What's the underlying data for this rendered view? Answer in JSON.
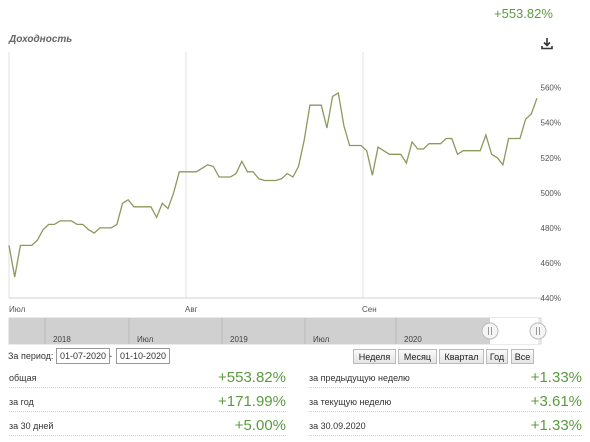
{
  "header": {
    "total_return": "+553.82%",
    "title": "Доходность",
    "download_icon": "download-icon"
  },
  "chart_data": {
    "type": "line",
    "title": "Доходность",
    "xlabel": "",
    "ylabel": "",
    "x_ticks": [
      "Июл",
      "Авг",
      "Сен"
    ],
    "y_ticks": [
      "440%",
      "460%",
      "480%",
      "500%",
      "520%",
      "540%",
      "560%"
    ],
    "ylim": [
      440,
      570
    ],
    "series_color": "#8a9a5b",
    "grid": "vertical lines at month starts",
    "series": [
      {
        "values": [
          470,
          452,
          470,
          470,
          470,
          473,
          479,
          482,
          482,
          484,
          484,
          484,
          482,
          482,
          479,
          477,
          480,
          480,
          480,
          482,
          494,
          496,
          492,
          492,
          492,
          492,
          486,
          494,
          491,
          500,
          512,
          512,
          512,
          512,
          514,
          516,
          515,
          509,
          509,
          509,
          511,
          518,
          512,
          512,
          508,
          507,
          507,
          507,
          508,
          511,
          509,
          515,
          530,
          550,
          550,
          550,
          537,
          555,
          557,
          538,
          527,
          527,
          527,
          524,
          510,
          526,
          524,
          522,
          522,
          522,
          517,
          529,
          525,
          525,
          528,
          528,
          528,
          531,
          531,
          522,
          524,
          524,
          524,
          524,
          533,
          522,
          520,
          516,
          531,
          531,
          531,
          542,
          545,
          554
        ]
      }
    ]
  },
  "navigator": {
    "labels": [
      "2018",
      "Июл",
      "2019",
      "Июл",
      "2020"
    ]
  },
  "period": {
    "label": "За период:",
    "from": "01-07-2020",
    "separator": "-",
    "to": "01-10-2020"
  },
  "range_buttons": [
    "Неделя",
    "Месяц",
    "Квартал",
    "Год",
    "Все"
  ],
  "stats_left": [
    {
      "label": "общая",
      "value": "+553.82%"
    },
    {
      "label": "за год",
      "value": "+171.99%"
    },
    {
      "label": "за 30 дней",
      "value": "+5.00%"
    }
  ],
  "stats_right": [
    {
      "label": "за предыдущую неделю",
      "value": "+1.33%"
    },
    {
      "label": "за текущую неделю",
      "value": "+3.61%"
    },
    {
      "label": "за 30.09.2020",
      "value": "+1.33%"
    }
  ]
}
